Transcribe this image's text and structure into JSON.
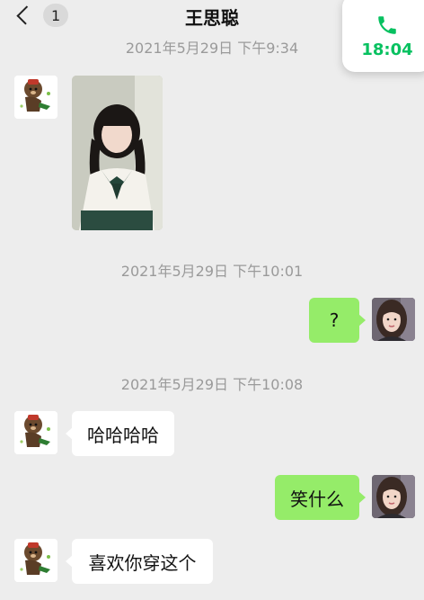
{
  "header": {
    "unread_count": "1",
    "title": "王思聪"
  },
  "call_widget": {
    "icon": "phone-icon",
    "duration": "18:04"
  },
  "messages": [
    {
      "type": "time",
      "text": "2021年5月29日 下午9:34"
    },
    {
      "type": "image",
      "side": "left"
    },
    {
      "type": "time",
      "text": "2021年5月29日 下午10:01"
    },
    {
      "type": "text",
      "side": "right",
      "text": "?"
    },
    {
      "type": "time",
      "text": "2021年5月29日 下午10:08"
    },
    {
      "type": "text",
      "side": "left",
      "text": "哈哈哈哈"
    },
    {
      "type": "text",
      "side": "right",
      "text": "笑什么"
    },
    {
      "type": "text",
      "side": "left",
      "text": "喜欢你穿这个"
    }
  ],
  "colors": {
    "background": "#ededed",
    "outgoing_bubble": "#95ec69",
    "incoming_bubble": "#ffffff",
    "call_accent": "#07c160"
  }
}
